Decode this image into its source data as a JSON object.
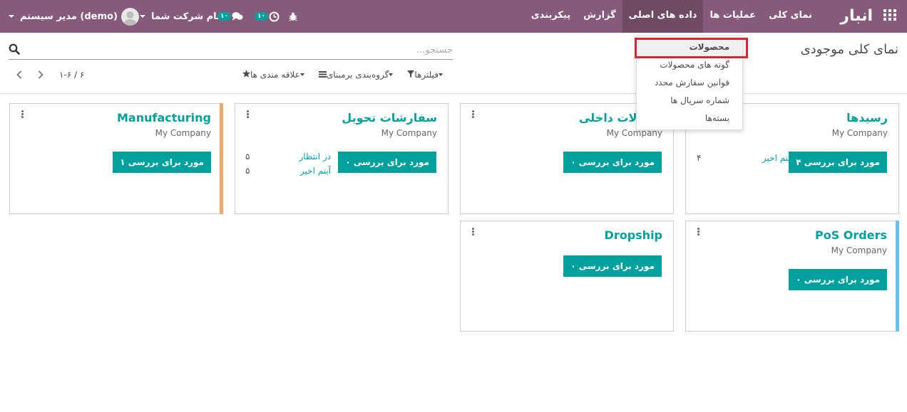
{
  "navbar": {
    "brand": "انبار",
    "menu": [
      {
        "label": "نمای کلی",
        "active": false
      },
      {
        "label": "عملیات ها",
        "active": false
      },
      {
        "label": "داده های اصلی",
        "active": true
      },
      {
        "label": "گزارش",
        "active": false
      },
      {
        "label": "پیکربندی",
        "active": false
      }
    ],
    "user_name": "مدیر سیستم (demo)",
    "company_name": "نام شرکت شما",
    "messages_count": "۱۰",
    "activities_count": "۱۰"
  },
  "control_panel": {
    "title": "نمای کلی موجودی",
    "search_placeholder": "جستجو...",
    "filters_label": "فیلترها",
    "groupby_label": "گروه‌بندی برمبنای",
    "favorites_label": "علاقه مندی ها",
    "pager_value": "۱-۶ / ۶"
  },
  "dropdown": {
    "items": [
      "محصولات",
      "گونه های محصولات",
      "قوانین سفارش مجدد",
      "شماره سریال ها",
      "بسته‌ها"
    ]
  },
  "cards": [
    {
      "title": "رسیدها",
      "company": "My Company",
      "button": "۴ مورد برای بررسی",
      "stats": [
        {
          "label": "آیتم اخیر",
          "value": "۴"
        }
      ],
      "stripe": ""
    },
    {
      "title": "انتقالات داخلی",
      "company": "My Company",
      "button": "۰ مورد برای بررسی",
      "stats": [],
      "stripe": ""
    },
    {
      "title": "سفارشات تحویل",
      "company": "My Company",
      "button": "۰ مورد برای بررسی",
      "stats": [
        {
          "label": "در انتظار",
          "value": "۵"
        },
        {
          "label": "آیتم اخیر",
          "value": "۵"
        }
      ],
      "stripe": ""
    },
    {
      "title": "Manufacturing",
      "company": "My Company",
      "button": "۱ مورد برای بررسی",
      "stats": [],
      "stripe": "#f0a868"
    },
    {
      "title": "PoS Orders",
      "company": "My Company",
      "button": "۰ مورد برای بررسی",
      "stats": [],
      "stripe": "#6cc1ed"
    },
    {
      "title": "Dropship",
      "company": "",
      "button": "۰ مورد برای بررسی",
      "stats": [],
      "stripe": ""
    }
  ],
  "colors": {
    "navbar": "#875a7b",
    "accent": "#00a09d",
    "highlight": "#d9232e"
  }
}
